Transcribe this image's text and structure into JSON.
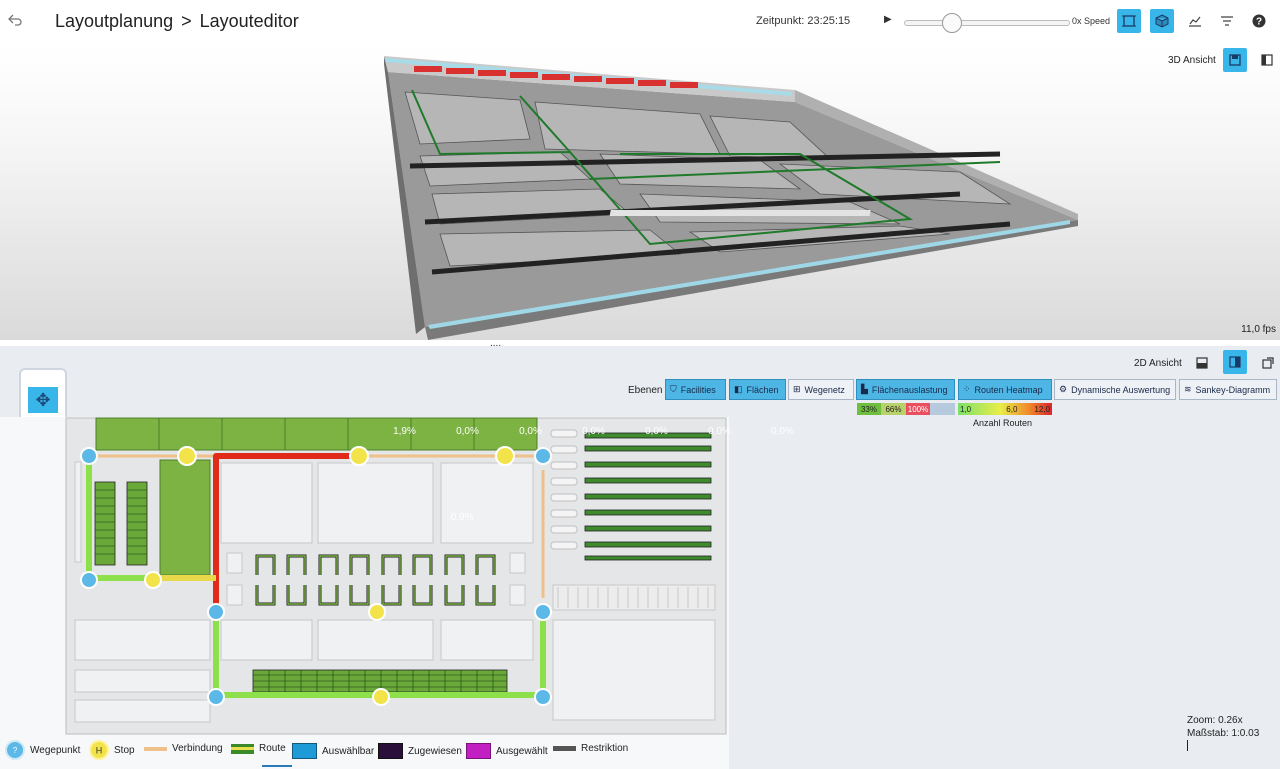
{
  "header": {
    "breadcrumb_root": "Layoutplanung",
    "breadcrumb_sep": ">",
    "breadcrumb_page": "Layouteditor",
    "time_label": "Zeitpunkt: 23:25:15",
    "speed_label": "0x Speed",
    "speed_slider_value": 0.25,
    "icons": [
      "back-icon",
      "play-icon",
      "frame-view-icon",
      "cube-icon",
      "chart-icon",
      "filter-icon",
      "help-icon"
    ]
  },
  "view3d": {
    "title": "3D Ansicht",
    "fps": "11,0 fps",
    "icons": [
      "save-icon",
      "split-icon"
    ]
  },
  "splitter_label": "....",
  "view2d": {
    "title": "2D Ansicht",
    "layers_label": "Ebenen",
    "layers": [
      {
        "label": "Facilities",
        "active": true,
        "icon": "facility-icon"
      },
      {
        "label": "Flächen",
        "active": true,
        "icon": "area-icon"
      },
      {
        "label": "Wegenetz",
        "active": false,
        "icon": "network-icon"
      },
      {
        "label": "Flächenauslastung",
        "active": true,
        "icon": "utilization-icon"
      },
      {
        "label": "Routen Heatmap",
        "active": true,
        "icon": "heatmap-icon"
      },
      {
        "label": "Dynamische Auswertung",
        "active": false,
        "icon": "dynamic-icon"
      },
      {
        "label": "Sankey-Diagramm",
        "active": false,
        "icon": "sankey-icon"
      }
    ],
    "utilization_scale": [
      "33%",
      "66%",
      "100%"
    ],
    "route_scale": [
      "1,0",
      "6,0",
      "12,0"
    ],
    "route_scale_label": "Anzahl Routen",
    "top_percentages": [
      "1,9%",
      "0,0%",
      "0,0%",
      "0,0%",
      "0,0%",
      "0,0%",
      "0,0%"
    ],
    "block_percentage": "0,9%",
    "zoom": "Zoom: 0.26x",
    "scale": "Maßstab: 1:0.03",
    "colors": {
      "accent": "#39b6e9",
      "facility_green": "#7cb342",
      "route_red": "#e53935",
      "route_green": "#8de04a",
      "connection": "#f0c08a"
    }
  },
  "legend": [
    {
      "label": "Wegepunkt",
      "icon": "waypoint-icon"
    },
    {
      "label": "Stop",
      "icon": "stop-icon"
    },
    {
      "label": "Verbindung",
      "icon": "connection-swatch"
    },
    {
      "label": "Route",
      "icon": "route-swatch"
    },
    {
      "label": "Auswählbar",
      "icon": "selectable-swatch"
    },
    {
      "label": "Zugewiesen",
      "icon": "assigned-swatch"
    },
    {
      "label": "Ausgewählt",
      "icon": "selected-swatch"
    },
    {
      "label": "Restriktion",
      "icon": "restriction-swatch"
    }
  ]
}
